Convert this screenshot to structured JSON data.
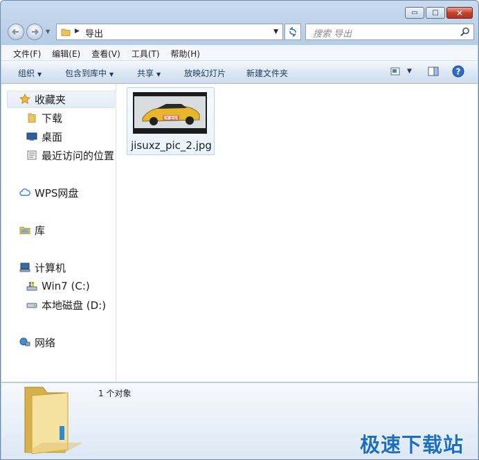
{
  "window": {
    "minimize_glyph": "▭",
    "maximize_glyph": "□",
    "close_glyph": "✕"
  },
  "address": {
    "path": "导出"
  },
  "search": {
    "placeholder": "搜索 导出"
  },
  "menu": [
    "文件(F)",
    "编辑(E)",
    "查看(V)",
    "工具(T)",
    "帮助(H)"
  ],
  "toolbar": {
    "organize": "组织",
    "include_library": "包含到库中",
    "share": "共享",
    "slideshow": "放映幻灯片",
    "new_folder": "新建文件夹"
  },
  "nav": {
    "favorites": "收藏夹",
    "downloads": "下载",
    "desktop": "桌面",
    "recent": "最近访问的位置",
    "wps": "WPS网盘",
    "library": "库",
    "computer": "计算机",
    "drive_c": "Win7 (C:)",
    "drive_d": "本地磁盘 (D:)",
    "network": "网络"
  },
  "files": [
    {
      "name": "jisuxz_pic_2.jpg"
    }
  ],
  "thumbnail": {
    "watermark": "软件 金排简"
  },
  "status": {
    "count": "1 个对象"
  },
  "watermark": "极速下载站",
  "colors": {
    "watermark": "#1b6fc2",
    "chrome": "#b9cfe7"
  }
}
